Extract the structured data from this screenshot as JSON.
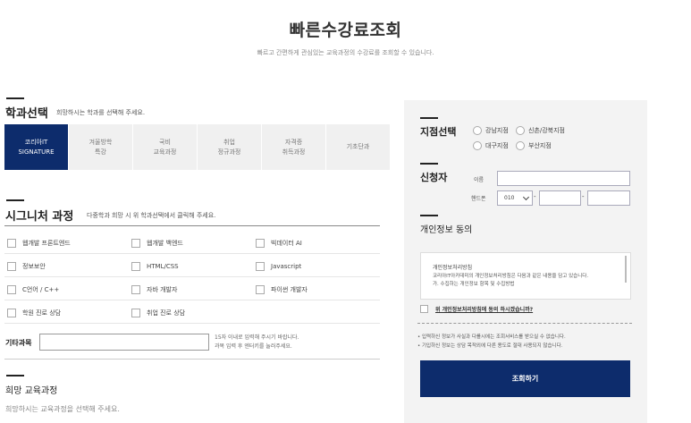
{
  "header": {
    "title": "빠른수강료조회",
    "subtitle": "빠르고 간편하게 관심있는 교육과정의 수강료를 조회할 수 있습니다."
  },
  "dept": {
    "title": "학과선택",
    "desc": "희망하시는 학과를 선택해 주세요.",
    "tabs": [
      {
        "line1": "코리아IT",
        "line2": "SIGNATURE"
      },
      {
        "line1": "겨울방학",
        "line2": "특강"
      },
      {
        "line1": "국비",
        "line2": "교육과정"
      },
      {
        "line1": "취업",
        "line2": "정규과정"
      },
      {
        "line1": "자격증",
        "line2": "취득과정"
      },
      {
        "line1": "기초단과",
        "line2": ""
      }
    ],
    "active_color": "#0d2c6c"
  },
  "signature": {
    "title": "시그니처 과정",
    "desc": "다중학과 희망 시 위 학과선택에서 클릭해 주세요.",
    "options": [
      [
        "웹개발 프론트엔드",
        "웹개발 백엔드",
        "빅데이터 AI"
      ],
      [
        "정보보안",
        "HTML/CSS",
        "Javascript"
      ],
      [
        "C언어 / C++",
        "자바 개발자",
        "파이썬 개발자"
      ],
      [
        "학원 진로 상담",
        "취업 진로 상담",
        ""
      ]
    ],
    "etc_label": "기타과목",
    "etc_note1": "15자 이내로 입력해 주시기 바랍니다.",
    "etc_note2": "과목 입력 후 엔터키를 눌러주세요."
  },
  "hope": {
    "title": "희망 교육과정",
    "desc": "희망하시는 교육과정을 선택해 주세요."
  },
  "branch": {
    "title": "지점선택",
    "options": [
      "강남지점",
      "신촌/강북지점",
      "대구지점",
      "부산지점"
    ]
  },
  "applicant": {
    "title": "신청자",
    "name_label": "이름",
    "phone_label": "핸드폰",
    "phone_prefix": "010",
    "dash": "-"
  },
  "privacy": {
    "title": "개인정보 동의",
    "box_title": "개인정보처리방침",
    "box_line1": "코리아IT아카데미의 개인정보처리방침은 다음과 같은 내용을 담고 있습니다.",
    "box_line2": "가. 수집하는 개인정보 항목 및 수집방법",
    "agree_text": "위 개인정보처리방침에 동의 하시겠습니까?",
    "note1": "• 입력하신 정보가 사실과 다를시에는 조회서비스를 받으실 수 없습니다.",
    "note2": "• 기입하신 정보는 상담 목적외에 다른 용도로 절대 사용되지 않습니다.",
    "submit_label": "조회하기"
  }
}
